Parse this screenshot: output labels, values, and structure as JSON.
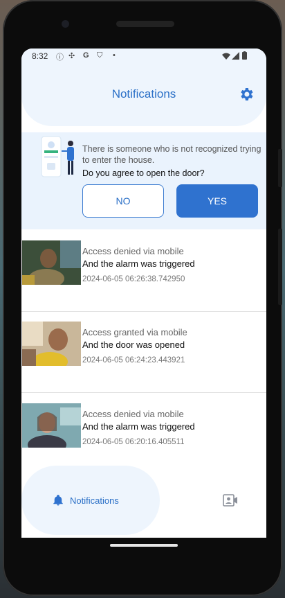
{
  "status_bar": {
    "time": "8:32",
    "icons": [
      "info-icon",
      "fan-icon",
      "google-icon",
      "shield-icon",
      "dot-icon",
      "wifi-icon",
      "signal-icon",
      "battery-icon"
    ]
  },
  "header": {
    "title": "Notifications",
    "settings_icon": "gear-icon"
  },
  "door_prompt": {
    "message": "There is someone who is not recognized trying to enter the house.",
    "question": "Do you agree to open the door?",
    "no_label": "NO",
    "yes_label": "YES"
  },
  "notifications": [
    {
      "status": "Access denied via mobile",
      "action": "And the alarm was triggered",
      "timestamp": "2024-06-05 06:26:38.742950"
    },
    {
      "status": "Access granted via mobile",
      "action": "And the door was opened",
      "timestamp": "2024-06-05 06:24:23.443921"
    },
    {
      "status": "Access denied via mobile",
      "action": "And the alarm was triggered",
      "timestamp": "2024-06-05 06:20:16.405511"
    }
  ],
  "bottom_nav": {
    "active_label": "Notifications",
    "active_icon": "bell-icon",
    "other_icon": "video-contact-icon"
  },
  "colors": {
    "accent": "#2f72cf",
    "header_bg": "#eef5fd",
    "prompt_bg": "#eaf3fd"
  }
}
